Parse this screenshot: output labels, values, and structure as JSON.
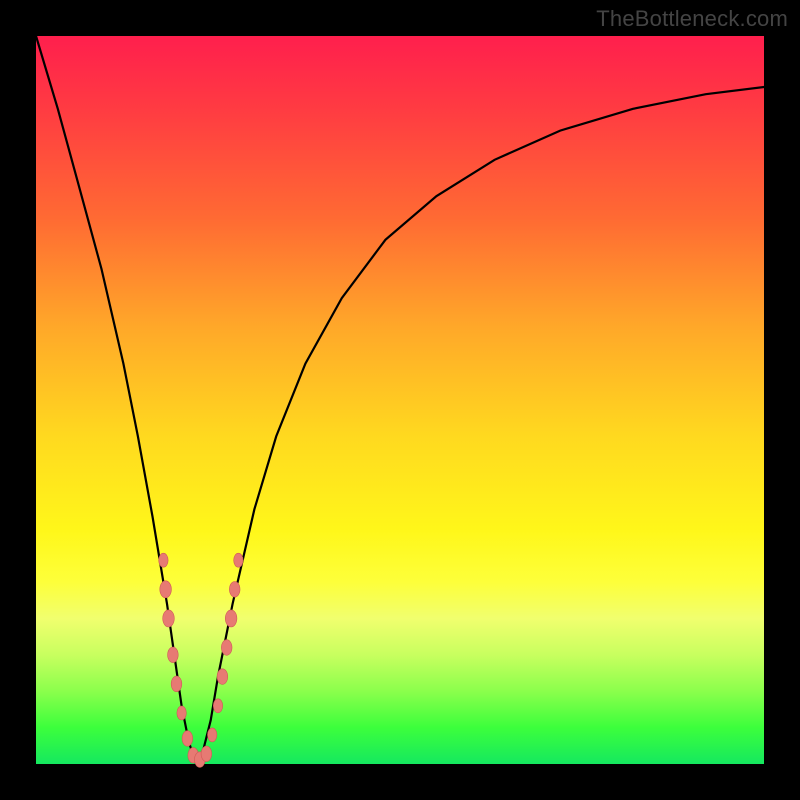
{
  "watermark": "TheBottleneck.com",
  "colors": {
    "frame": "#000000",
    "curve": "#000000",
    "marker_fill": "#e77a73",
    "marker_stroke": "#cf5a56"
  },
  "chart_data": {
    "type": "line",
    "title": "",
    "xlabel": "",
    "ylabel": "",
    "xlim": [
      0,
      100
    ],
    "ylim": [
      0,
      100
    ],
    "note": "Bottleneck curve; y ≈ percentage bottleneck (100 top, 0 bottom), x ≈ relative component performance. Minimum ~x=22 where bottleneck ≈ 0.",
    "series": [
      {
        "name": "bottleneck-curve",
        "x": [
          0,
          3,
          6,
          9,
          12,
          14,
          16,
          18,
          19,
          20,
          21,
          22,
          23,
          24,
          25,
          27,
          30,
          33,
          37,
          42,
          48,
          55,
          63,
          72,
          82,
          92,
          100
        ],
        "y": [
          100,
          90,
          79,
          68,
          55,
          45,
          34,
          22,
          15,
          8,
          3,
          0,
          2,
          6,
          12,
          22,
          35,
          45,
          55,
          64,
          72,
          78,
          83,
          87,
          90,
          92,
          93
        ]
      }
    ],
    "markers": {
      "name": "sample-points",
      "note": "Salmon rounded markers clustered near the curve minimum on both branches.",
      "points": [
        {
          "x": 17.5,
          "y": 28,
          "r": 4.5
        },
        {
          "x": 17.8,
          "y": 24,
          "r": 5.5
        },
        {
          "x": 18.2,
          "y": 20,
          "r": 5.5
        },
        {
          "x": 18.8,
          "y": 15,
          "r": 5
        },
        {
          "x": 19.3,
          "y": 11,
          "r": 5
        },
        {
          "x": 20.0,
          "y": 7,
          "r": 4.5
        },
        {
          "x": 20.8,
          "y": 3.5,
          "r": 5
        },
        {
          "x": 21.6,
          "y": 1.2,
          "r": 5
        },
        {
          "x": 22.5,
          "y": 0.6,
          "r": 5
        },
        {
          "x": 23.4,
          "y": 1.4,
          "r": 5
        },
        {
          "x": 24.2,
          "y": 4,
          "r": 4.5
        },
        {
          "x": 25.0,
          "y": 8,
          "r": 4.5
        },
        {
          "x": 25.6,
          "y": 12,
          "r": 5
        },
        {
          "x": 26.2,
          "y": 16,
          "r": 5
        },
        {
          "x": 26.8,
          "y": 20,
          "r": 5.5
        },
        {
          "x": 27.3,
          "y": 24,
          "r": 5
        },
        {
          "x": 27.8,
          "y": 28,
          "r": 4.5
        }
      ]
    }
  }
}
